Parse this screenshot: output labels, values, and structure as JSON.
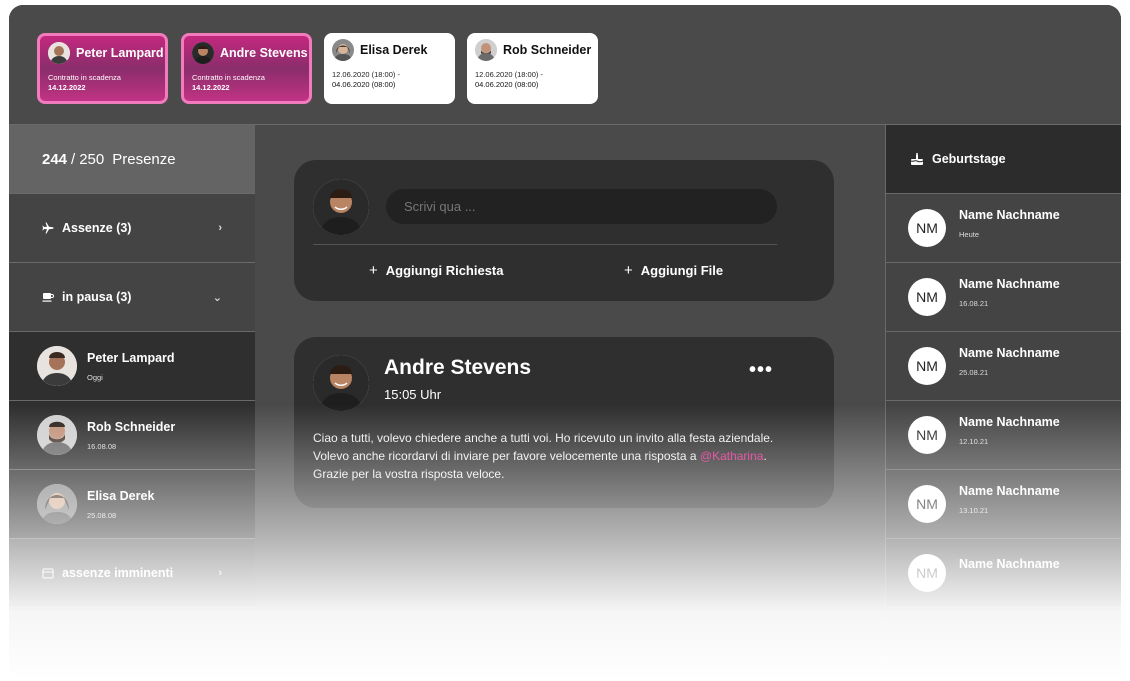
{
  "top_cards": [
    {
      "name": "Peter Lampard",
      "line1": "Contratto in scadenza",
      "line2": "14.12.2022"
    },
    {
      "name": "Andre Stevens",
      "line1": "Contratto in scadenza",
      "line2": "14.12.2022"
    },
    {
      "name": "Elisa Derek",
      "line1": "12.06.2020 (18:00) -",
      "line2": "04.06.2020 (08:00)"
    },
    {
      "name": "Rob Schneider",
      "line1": "12.06.2020 (18:00) -",
      "line2": "04.06.2020 (08:00)"
    }
  ],
  "presence": {
    "count": "244",
    "separator": "/",
    "total": "250",
    "label": "Presenze"
  },
  "left_menu": {
    "absences": {
      "label": "Assenze (3)",
      "icon": "airplane-icon",
      "chevron": "›"
    },
    "on_break": {
      "label": "in pausa (3)",
      "icon": "coffee-icon",
      "chevron": "⌄"
    },
    "upcoming": {
      "label": "assenze imminenti",
      "icon": "calendar-icon",
      "chevron": "›"
    }
  },
  "left_people": [
    {
      "name": "Peter Lampard",
      "date": "Oggi"
    },
    {
      "name": "Rob Schneider",
      "date": "16.08.08"
    },
    {
      "name": "Elisa Derek",
      "date": "25.08.08"
    }
  ],
  "compose": {
    "placeholder": "Scrivi qua ...",
    "add_request": "Aggiungi Richiesta",
    "add_file": "Aggiungi File"
  },
  "post": {
    "author": "Andre Stevens",
    "time": "15:05 Uhr",
    "line1": "Ciao a tutti, volevo chiedere anche a tutti voi. Ho ricevuto un invito alla festa aziendale.",
    "line2_prefix": "Volevo anche ricordarvi di inviare per favore velocemente una risposta a ",
    "mention": "@Katharina",
    "line2_suffix": ".",
    "line3": "Grazie per la vostra risposta veloce."
  },
  "birthdays": {
    "title": "Geburtstage",
    "items": [
      {
        "initials": "NM",
        "name": "Name Nachname",
        "date": "Heute"
      },
      {
        "initials": "NM",
        "name": "Name Nachname",
        "date": "16.08.21"
      },
      {
        "initials": "NM",
        "name": "Name Nachname",
        "date": "25.08.21"
      },
      {
        "initials": "NM",
        "name": "Name Nachname",
        "date": "12.10.21"
      },
      {
        "initials": "NM",
        "name": "Name Nachname",
        "date": "13.10.21"
      },
      {
        "initials": "NM",
        "name": "Name Nachname",
        "date": ""
      }
    ]
  },
  "colors": {
    "accent_pink": "#e0288d",
    "panel_dark": "#2f2f2f",
    "background": "#4a4a4a"
  }
}
